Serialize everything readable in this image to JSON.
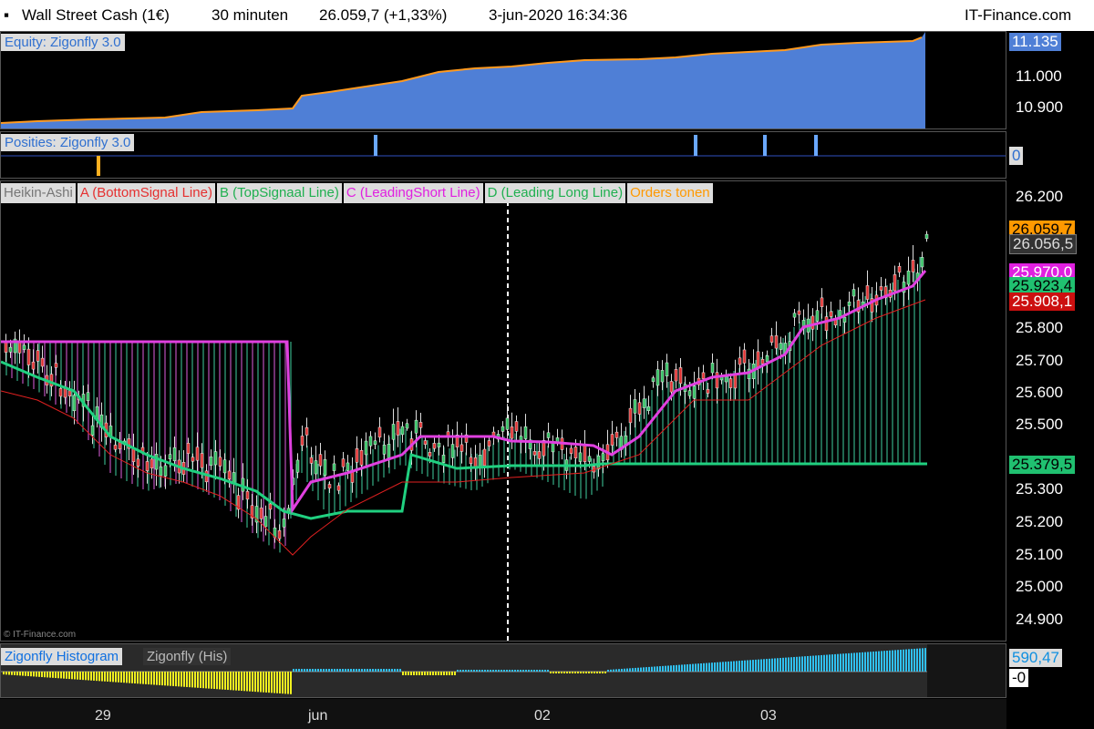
{
  "titlebar": {
    "instrument": "Wall Street Cash (1€)",
    "timeframe": "30 minuten",
    "price": "26.059,7 (+1,33%)",
    "datetime": "3-jun-2020 16:34:36",
    "brand": "IT-Finance.com"
  },
  "equity": {
    "label": "Equity: Zigonfly 3.0",
    "ticks": [
      "11.000",
      "10.900"
    ],
    "current": "11.135",
    "color": "#5b8fe0"
  },
  "positions": {
    "label": "Posities: Zigonfly 3.0",
    "current": "0"
  },
  "main": {
    "legend": [
      {
        "text": "Heikin-Ashi",
        "color": "#777777"
      },
      {
        "text": "A (BottomSignal Line)",
        "color": "#e53030"
      },
      {
        "text": "B (TopSignaal Line)",
        "color": "#20b050"
      },
      {
        "text": "C (LeadingShort Line)",
        "color": "#e020e0"
      },
      {
        "text": "D (Leading Long Line)",
        "color": "#20b050"
      },
      {
        "text": "Orders tonen",
        "color": "#ff9900"
      }
    ],
    "ticks": [
      "26.200",
      "25.800",
      "25.700",
      "25.600",
      "25.500",
      "25.300",
      "25.200",
      "25.100",
      "25.000",
      "24.900"
    ],
    "price_boxes": [
      {
        "text": "26.059,7",
        "bg": "#ff9900",
        "fg": "#000000"
      },
      {
        "text": "26.056,5",
        "bg": "#333333",
        "fg": "#dddddd"
      },
      {
        "text": "25.970,0",
        "bg": "#e020e0",
        "fg": "#ffffff"
      },
      {
        "text": "25.923,4",
        "bg": "#20c070",
        "fg": "#000000"
      },
      {
        "text": "25.908,1",
        "bg": "#cc1010",
        "fg": "#ffffff"
      },
      {
        "text": "25.379,5",
        "bg": "#20c070",
        "fg": "#000000"
      }
    ],
    "copyright": "© IT-Finance.com"
  },
  "histogram": {
    "label": "Zigonfly Histogram",
    "label2": "Zigonfly (His)",
    "current": "590,47",
    "zero": "-0"
  },
  "xaxis": [
    "29",
    "jun",
    "02",
    "03"
  ]
}
